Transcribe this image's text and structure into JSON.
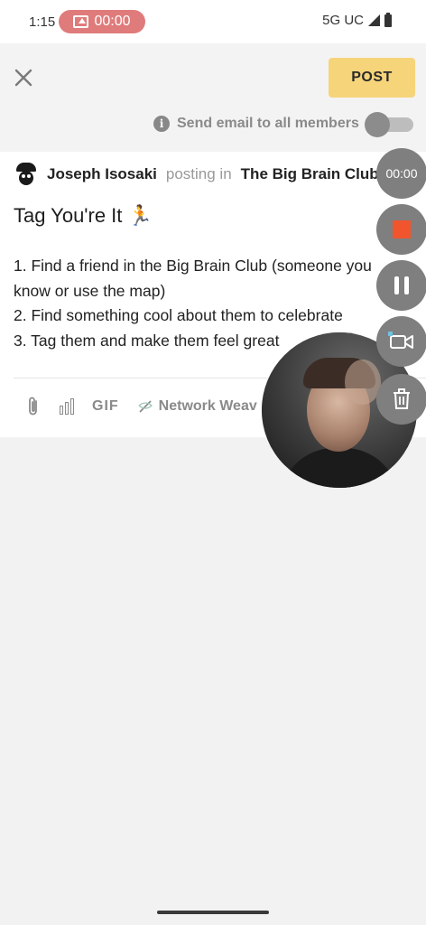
{
  "status_bar": {
    "time": "1:15",
    "recording_timer": "00:00",
    "network": "5G UC"
  },
  "app_bar": {
    "close_icon": "close-icon",
    "post_label": "POST",
    "email_toggle_label": "Send email to all members",
    "email_toggle_on": false
  },
  "post": {
    "author": "Joseph Isosaki",
    "posting_in": "posting in",
    "group": "The Big Brain Club [..",
    "title": "Tag You're It 🏃",
    "body_lines": [
      "1. Find a friend in the Big Brain Club (someone you",
      "know or use the map)",
      "2. Find something cool about them to celebrate",
      "3. Tag them and make them feel great"
    ]
  },
  "toolbar": {
    "attach_icon": "paperclip-icon",
    "poll_icon": "bar-chart-icon",
    "gif_label": "GIF",
    "weave_icon": "needle-thread-icon",
    "weave_label": "Network Weav"
  },
  "recorder": {
    "timer": "00:00",
    "stop_color": "#f0552e",
    "icons": [
      "stop-icon",
      "pause-icon",
      "video-camera-icon",
      "trash-icon"
    ]
  },
  "colors": {
    "post_button": "#f6d47a",
    "recording_pill": "#e07b7b",
    "fab_background": "#7f7f7f"
  }
}
